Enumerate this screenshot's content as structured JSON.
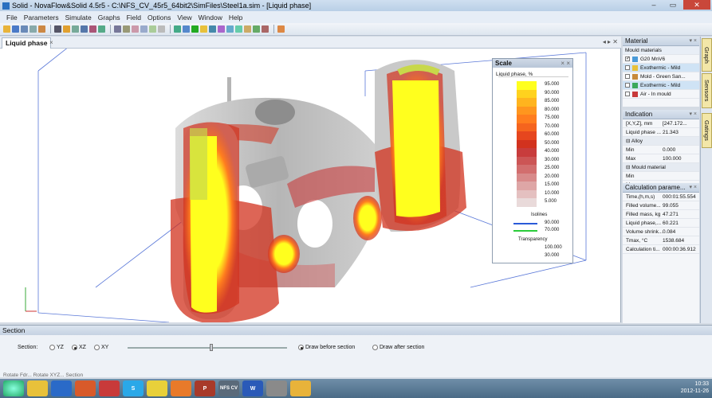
{
  "window": {
    "title": "Solid - NovaFlow&Solid 4.5r5 - C:\\NFS_CV_45r5_64bit2\\SimFiles\\Steel1a.sim - [Liquid phase]"
  },
  "menu": [
    "File",
    "Parameters",
    "Simulate",
    "Graphs",
    "Field",
    "Options",
    "View",
    "Window",
    "Help"
  ],
  "view_tab": {
    "label": "Liquid phase",
    "close": "×"
  },
  "scale": {
    "title": "Scale",
    "subtitle": "Liquid phase, %",
    "values": [
      "95.000",
      "90.000",
      "85.000",
      "80.000",
      "75.000",
      "70.000",
      "60.000",
      "50.000",
      "40.000",
      "30.000",
      "25.000",
      "20.000",
      "15.000",
      "10.000",
      "5.000"
    ],
    "colors": [
      "#ffff1e",
      "#ffd21e",
      "#ffb41e",
      "#ff961e",
      "#ff7d1e",
      "#f5641e",
      "#e6461e",
      "#d2321e",
      "#c83c3c",
      "#cc5555",
      "#d26e6e",
      "#d88a8a",
      "#dea6a6",
      "#e4c0c0",
      "#e9dada"
    ],
    "isolines_label": "Isolines",
    "isolines": [
      {
        "value": "90.000",
        "color": "#2a5bd8"
      },
      {
        "value": "70.000",
        "color": "#2acc3a"
      }
    ],
    "transparency_label": "Transparency",
    "transparency": [
      "100.000",
      "30.000"
    ]
  },
  "material": {
    "title": "Material",
    "tab": "Mould materials",
    "items": [
      {
        "label": "G20 MnV6",
        "color": "#4a9ad8",
        "checked": true
      },
      {
        "label": "Exothermic - Mild",
        "color": "#e8c13a",
        "checked": false
      },
      {
        "label": "Mold - Green San...",
        "color": "#c88a3a",
        "checked": false
      },
      {
        "label": "Exothermic - Mild",
        "color": "#3aa85a",
        "checked": false
      },
      {
        "label": "Air - In mould",
        "color": "#c83a3a",
        "checked": false
      }
    ]
  },
  "indication": {
    "title": "Indication",
    "rows": [
      {
        "k": "[X,Y,Z], mm",
        "v": "[247.172..."
      },
      {
        "k": "Liquid phase ...",
        "v": "21.343"
      },
      {
        "k": "⊟ Alloy",
        "v": ""
      },
      {
        "k": "Min",
        "v": "0.000"
      },
      {
        "k": "Max",
        "v": "100.000"
      },
      {
        "k": "⊟ Mould material",
        "v": ""
      },
      {
        "k": "Min",
        "v": ""
      },
      {
        "k": "Max",
        "v": ""
      }
    ]
  },
  "calc": {
    "title": "Calculation parame...",
    "rows": [
      {
        "k": "Time,(h,m,s)",
        "v": "000:01:55.554"
      },
      {
        "k": "Filled volume...",
        "v": "99.055"
      },
      {
        "k": "Filled mass, kg",
        "v": "47.271"
      },
      {
        "k": "Liquid phase,...",
        "v": "60.221"
      },
      {
        "k": "Volume shrink...",
        "v": "0.084"
      },
      {
        "k": "Tmax, °C",
        "v": "1538.684"
      },
      {
        "k": "Calculation ti...",
        "v": "000:00:36.912"
      }
    ]
  },
  "side_tabs": [
    "Graph",
    "Sensors",
    "Gatings"
  ],
  "section": {
    "title": "Section",
    "label": "Section:",
    "planes": [
      "YZ",
      "XZ",
      "XY"
    ],
    "selected": "XZ",
    "draw_before": "Draw before section",
    "draw_after": "Draw after section"
  },
  "bottom_tabs": "Rotate Fdr... Rotate XYZ... Section",
  "taskbar": {
    "apps": [
      "",
      "",
      "",
      "",
      "S",
      "",
      "",
      "",
      "P",
      "NFS CV",
      "W",
      "",
      ""
    ],
    "time": "10:33",
    "date": "2012-11-26"
  }
}
